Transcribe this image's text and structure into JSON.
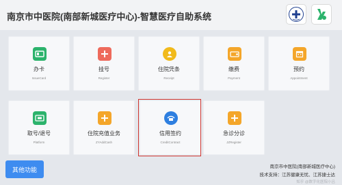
{
  "header": {
    "title": "南京市中医院(南部新城医疗中心)-智慧医疗自助系统"
  },
  "tiles": [
    {
      "cn": "办卡",
      "en": "IssueCard",
      "icon": "card-icon",
      "color": "#2cb36c"
    },
    {
      "cn": "挂号",
      "en": "Register",
      "icon": "plus-icon",
      "color": "#ee6a5c"
    },
    {
      "cn": "住院凭条",
      "en": "Receipt",
      "icon": "person-icon",
      "color": "#f1ba1b"
    },
    {
      "cn": "缴费",
      "en": "Payment",
      "icon": "wallet-icon",
      "color": "#f4a62a"
    },
    {
      "cn": "预约",
      "en": "Appointment",
      "icon": "calendar-icon",
      "color": "#f4a62a"
    },
    {
      "cn": "取号/退号",
      "en": "Platform",
      "icon": "ticket-icon",
      "color": "#2cb36c"
    },
    {
      "cn": "住院充值业务",
      "en": "ZYAddCash",
      "icon": "plus-icon",
      "color": "#f4a62a"
    },
    {
      "cn": "信用签约",
      "en": "CreditContract",
      "icon": "credit-icon",
      "color": "#2e7fe0"
    },
    {
      "cn": "急诊分诊",
      "en": "JZRegister",
      "icon": "plus-icon",
      "color": "#f4a62a"
    }
  ],
  "other_button": "其他功能",
  "footer": {
    "line1": "南京市中医院(南部新城医疗中心)",
    "line2": "技术支持：江苏健康无忧、江苏捷士达",
    "line3": "知乎 @数字化医院小吕"
  }
}
